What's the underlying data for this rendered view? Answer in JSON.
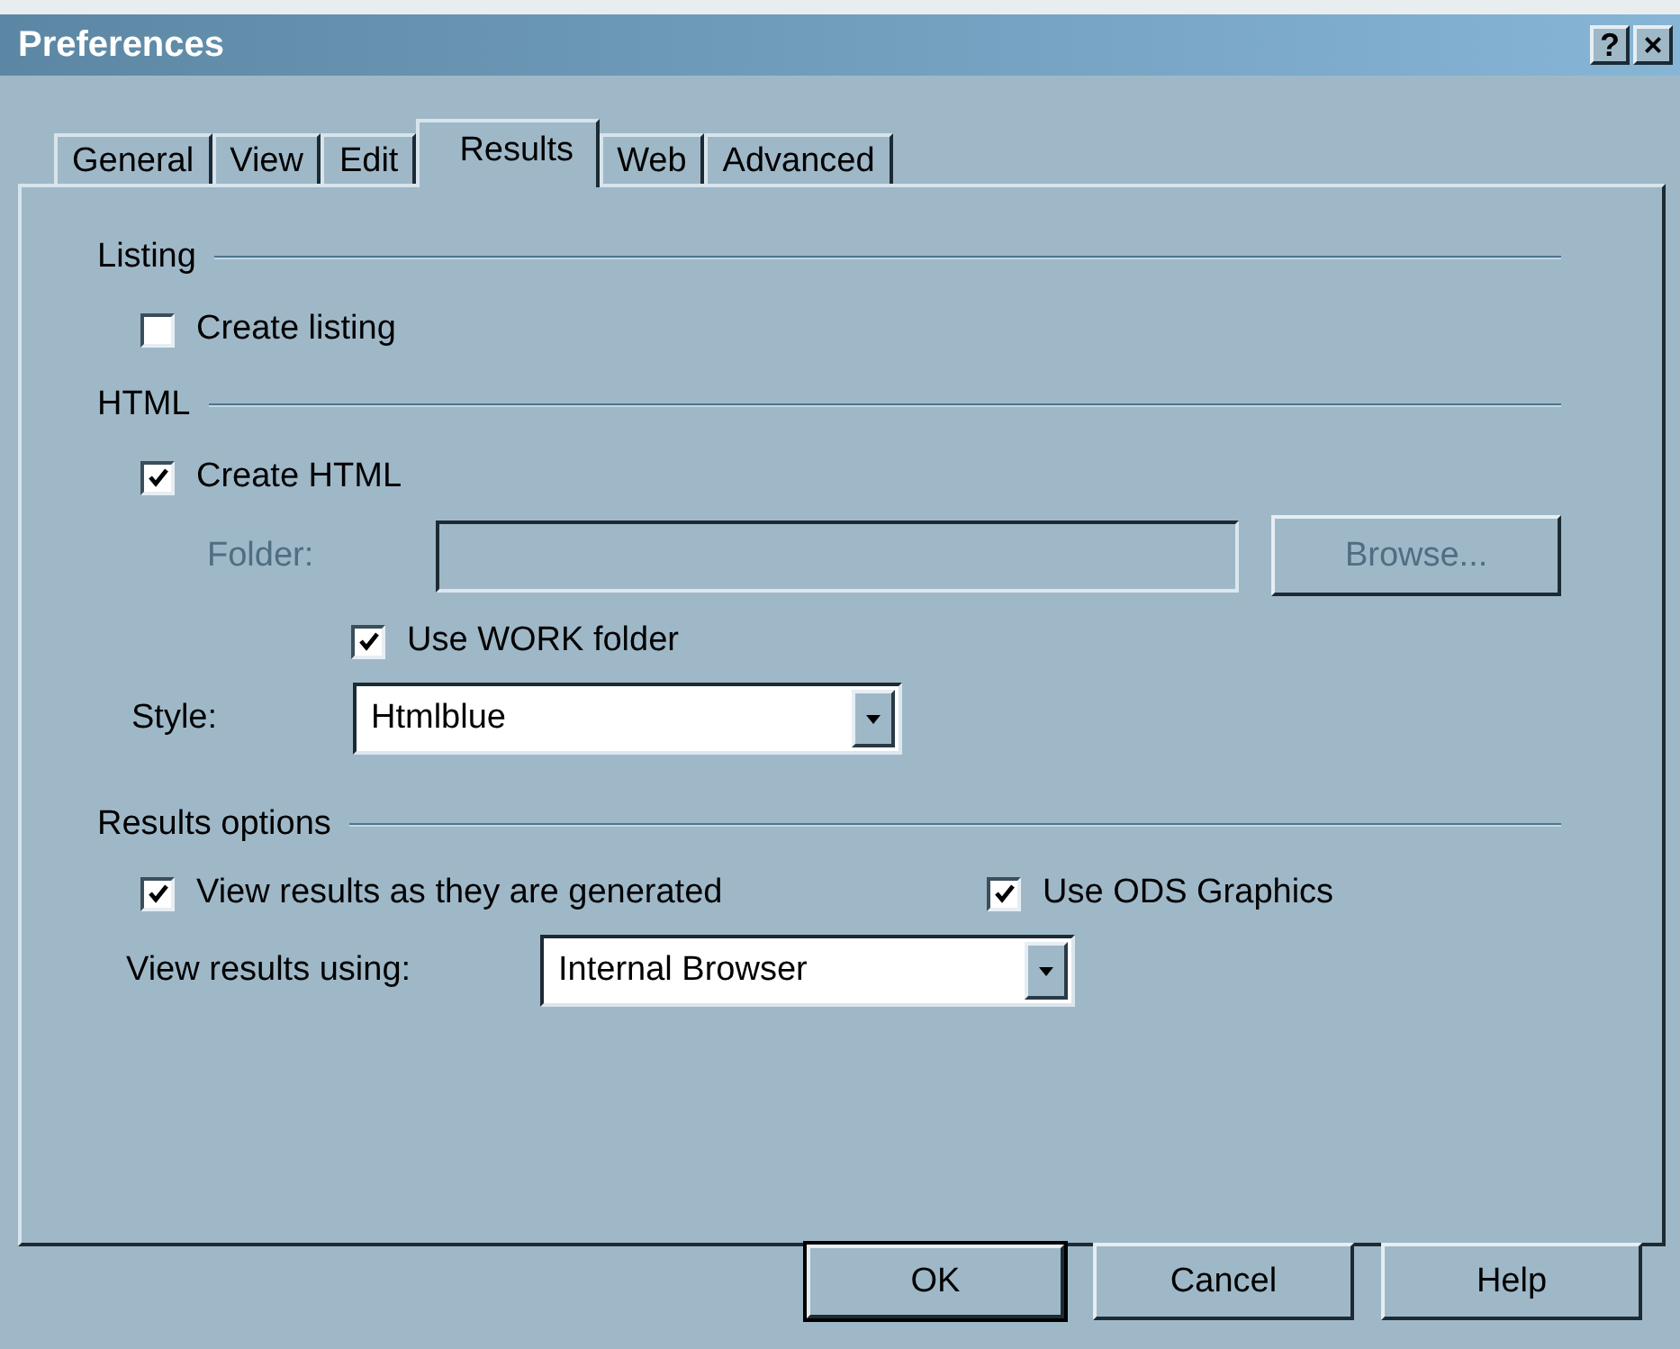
{
  "window": {
    "title": "Preferences",
    "help_button": "?",
    "close_button": "×"
  },
  "tabs": [
    {
      "label": "General",
      "selected": false
    },
    {
      "label": "View",
      "selected": false
    },
    {
      "label": "Edit",
      "selected": false
    },
    {
      "label": "Results",
      "selected": true
    },
    {
      "label": "Web",
      "selected": false
    },
    {
      "label": "Advanced",
      "selected": false
    }
  ],
  "listing": {
    "heading": "Listing",
    "create_listing": {
      "label": "Create listing",
      "checked": false
    }
  },
  "html": {
    "heading": "HTML",
    "create_html": {
      "label": "Create HTML",
      "checked": true
    },
    "folder": {
      "label": "Folder:",
      "disabled": true,
      "browse_button": "Browse..."
    },
    "use_work_folder": {
      "label": "Use WORK folder",
      "checked": true
    },
    "style": {
      "label": "Style:",
      "value": "Htmlblue"
    }
  },
  "results_options": {
    "heading": "Results options",
    "view_results": {
      "label": "View results as they are generated",
      "checked": true
    },
    "use_ods_graphics": {
      "label": "Use ODS Graphics",
      "checked": true
    },
    "view_using": {
      "label": "View results using:",
      "value": "Internal Browser"
    }
  },
  "buttons": [
    {
      "label": "OK",
      "default": true
    },
    {
      "label": "Cancel",
      "default": false
    },
    {
      "label": "Help",
      "default": false
    }
  ]
}
